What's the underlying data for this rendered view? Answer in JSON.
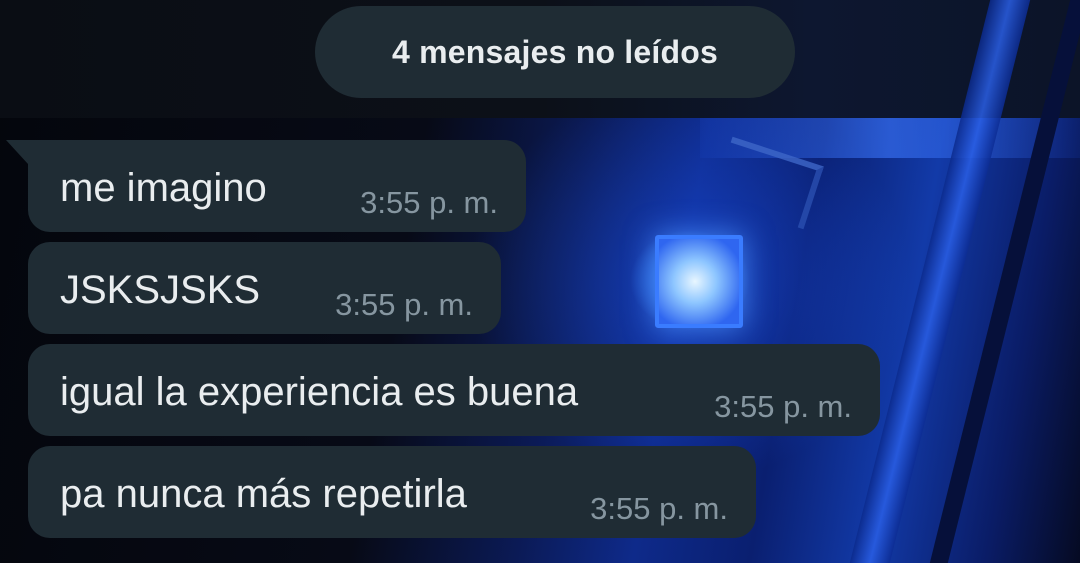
{
  "unread_banner": {
    "label": "4 mensajes no leídos"
  },
  "messages": [
    {
      "text": "me imagino",
      "time": "3:55 p. m."
    },
    {
      "text": "JSKSJSKS",
      "time": "3:55 p. m."
    },
    {
      "text": "igual la experiencia es buena",
      "time": "3:55 p. m."
    },
    {
      "text": "pa nunca más repetirla",
      "time": "3:55 p. m."
    }
  ],
  "colors": {
    "bubble_background": "#1f2c34",
    "message_text": "#e9edef",
    "timestamp_text": "#8696a0",
    "wallpaper_accent": "#1e4fe0"
  }
}
